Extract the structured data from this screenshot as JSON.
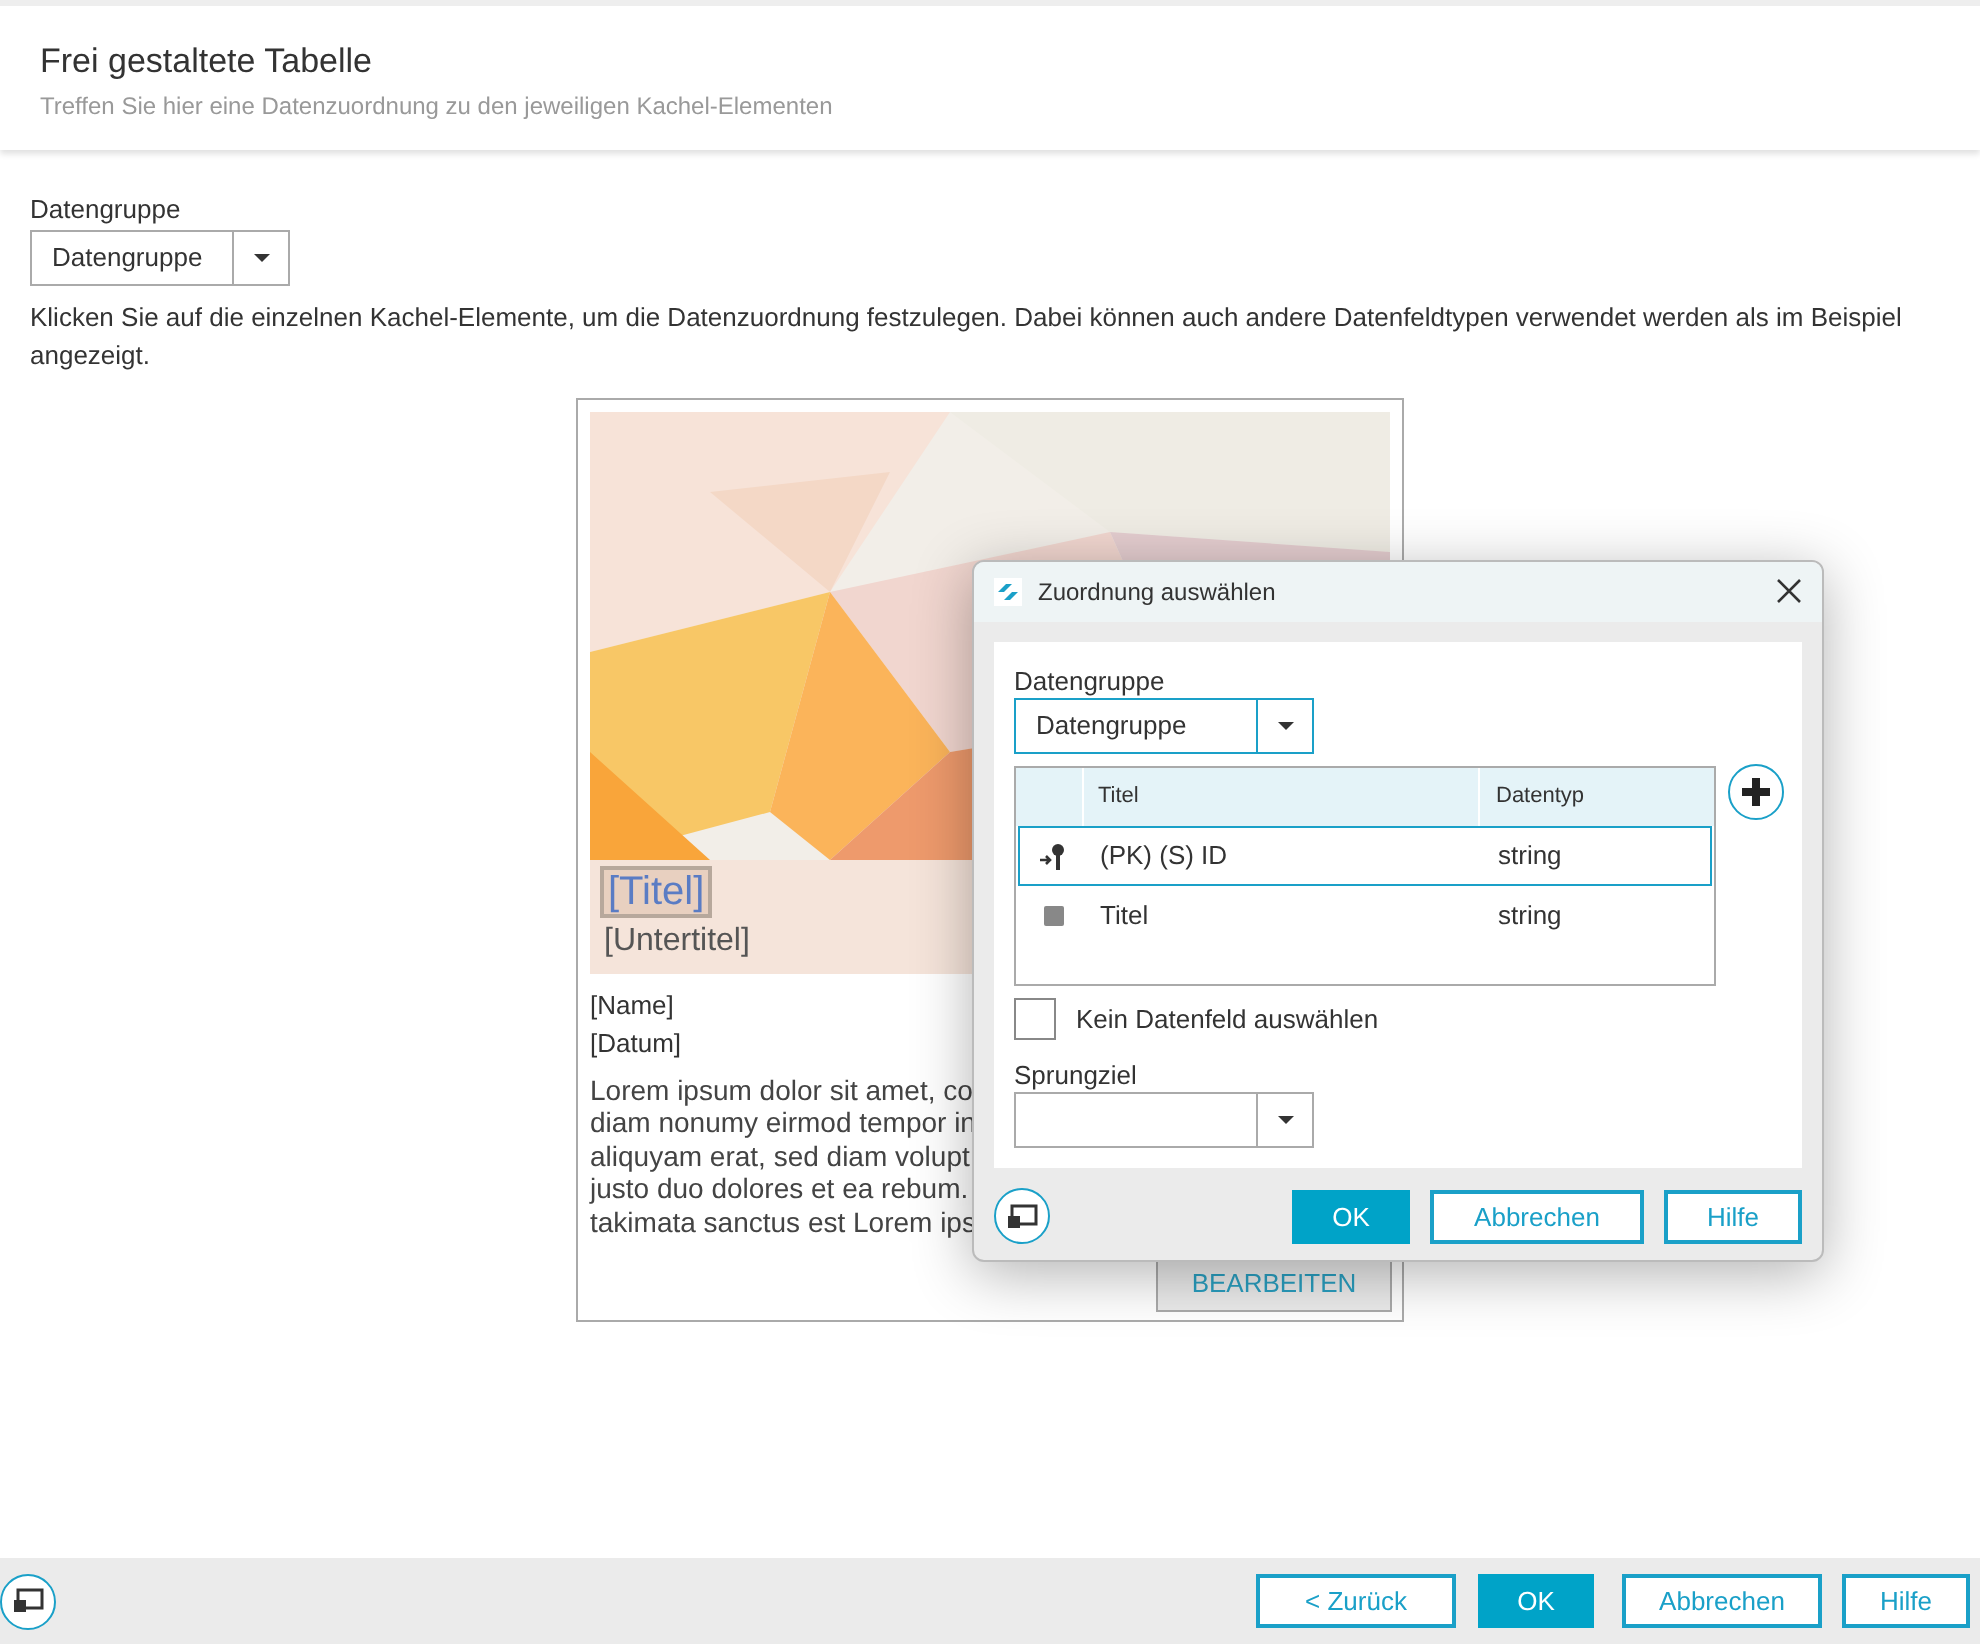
{
  "header": {
    "title": "Frei gestaltete Tabelle",
    "subtitle": "Treffen Sie hier eine Datenzuordnung zu den jeweiligen Kachel-Elementen"
  },
  "data_group": {
    "label": "Datengruppe",
    "value": "Datengruppe"
  },
  "instructions": "Klicken Sie auf die einzelnen Kachel-Elemente, um die Datenzuordnung festzulegen. Dabei können auch andere Datenfeldtypen verwendet werden als im Beispiel angezeigt.",
  "tile": {
    "title": "[Titel]",
    "subtitle": "[Untertitel]",
    "name": "[Name]",
    "date": "[Datum]",
    "body_lines": [
      "Lorem ipsum dolor sit amet, co",
      "diam nonumy eirmod tempor in",
      "aliquyam erat, sed diam volupt",
      "justo duo dolores et ea rebum.",
      "takimata sanctus est Lorem ips"
    ],
    "edit_button": "BEARBEITEN"
  },
  "dialog": {
    "title": "Zuordnung auswählen",
    "group_label": "Datengruppe",
    "group_value": "Datengruppe",
    "columns": [
      "Titel",
      "Datentyp"
    ],
    "rows": [
      {
        "kind": "key",
        "title": "(PK) (S) ID",
        "type": "string",
        "selected": true
      },
      {
        "kind": "field",
        "title": "Titel",
        "type": "string",
        "selected": false
      }
    ],
    "no_field": {
      "label": "Kein Datenfeld auswählen",
      "checked": false
    },
    "target_label": "Sprungziel",
    "buttons": [
      {
        "label": "OK",
        "kind": "primary"
      },
      {
        "label": "Abbrechen",
        "kind": "outline"
      },
      {
        "label": "Hilfe",
        "kind": "outline"
      }
    ]
  },
  "footer": {
    "buttons": [
      {
        "label": "< Zurück",
        "kind": "outline"
      },
      {
        "label": "OK",
        "kind": "primary"
      },
      {
        "label": "Abbrechen",
        "kind": "outline"
      },
      {
        "label": "Hilfe",
        "kind": "outline"
      }
    ]
  }
}
